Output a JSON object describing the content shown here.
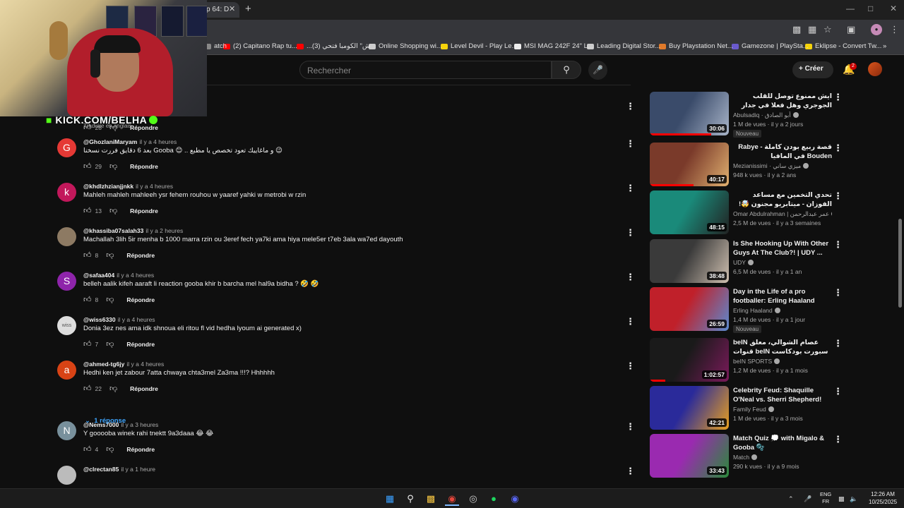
{
  "browser": {
    "tab_title": "p 64: D",
    "tab_close": "✕",
    "new_tab": "+",
    "bookmarks": [
      {
        "label": "atch",
        "color": "#888888"
      },
      {
        "label": "(2) Capitano Rap tu...",
        "color": "#ff0000"
      },
      {
        "label": "...ش\" الكومبا فتحي (3)",
        "color": "#ff0000"
      },
      {
        "label": "Online Shopping wi...",
        "color": "#cccccc"
      },
      {
        "label": "Level Devil - Play Le...",
        "color": "#f5d30a"
      },
      {
        "label": "MSI MAG 242F 24\" L...",
        "color": "#eeeeee"
      },
      {
        "label": "Leading Digital Stor...",
        "color": "#cccccc"
      },
      {
        "label": "Buy Playstation Net...",
        "color": "#e07a2a"
      },
      {
        "label": "Gamezone | PlaySta...",
        "color": "#6a5acd"
      },
      {
        "label": "Eklipse - Convert Tw...",
        "color": "#f5d30a"
      }
    ],
    "bookmarks_more": "»"
  },
  "stream_overlay": {
    "kick_text": "KICK.COM/BELHA",
    "peek_text": "Traduire en anglais"
  },
  "youtube": {
    "search_placeholder": "Rechercher",
    "create_label": "Créer",
    "notif_count": "2"
  },
  "comments": [
    {
      "author": "",
      "time": "",
      "text": "",
      "likes": "28",
      "reply": "Répondre",
      "avatar_text": "",
      "avatar_color": "#0f0f0f"
    },
    {
      "author": "@GhozlaniMaryam",
      "time": "il y a 4 heures",
      "text": "بعد 6 دقايق فررت نسخنا Gooba 😊 .. و ماغاييك تعود تخصص يا مطبع 😉",
      "likes": "29",
      "reply": "Répondre",
      "avatar_text": "G",
      "avatar_color": "#e53935"
    },
    {
      "author": "@khdlzhzianjjnkk",
      "time": "il y a 4 heures",
      "text": "Mahleh mahleh mahleeh ysr fehem rouhou w yaaref yahki w metrobi w rzin",
      "likes": "13",
      "reply": "Répondre",
      "avatar_text": "k",
      "avatar_color": "#c2185b"
    },
    {
      "author": "@khassiba07salah33",
      "time": "il y a 2 heures",
      "text": "Machallah 3lih 5ir menha b 1000 marra rzin ou 3eref fech ya7ki ama hiya mele5er t7eb 3ala wa7ed dayouth",
      "likes": "8",
      "reply": "Répondre",
      "avatar_text": "",
      "avatar_color": "#8d7a63"
    },
    {
      "author": "@safaa404",
      "time": "il y a 4 heures",
      "text": "belleh aalik kifeh aaraft li reaction gooba khir b barcha mel hal9a bidha ? 🤣 🤣",
      "likes": "8",
      "reply": "Répondre",
      "avatar_text": "S",
      "avatar_color": "#8e24aa"
    },
    {
      "author": "@wiss6330",
      "time": "il y a 4 heures",
      "text": "Donia 3ez nes ama idk shnoua eli ritou fl vid hedha lyoum ai generated x)",
      "likes": "7",
      "reply": "Répondre",
      "avatar_text": "wiss",
      "avatar_color": "#dddddd"
    },
    {
      "author": "@ahmed-tg6jy",
      "time": "il y a 4 heures",
      "text": "Hedhi ken jet zabour 7atta chwaya chta3mel Za3ma !!!? Hhhhhh",
      "likes": "22",
      "reply": "Répondre",
      "avatar_text": "a",
      "avatar_color": "#d84315"
    },
    {
      "author": "@Nems7000",
      "time": "il y a 3 heures",
      "text": "Y gooooba winek rahi tnektt 9a3daaa 😂 😂",
      "likes": "4",
      "reply": "Répondre",
      "avatar_text": "N",
      "avatar_color": "#78909c"
    },
    {
      "author": "@clrectan85",
      "time": "il y a 1 heure",
      "text": "",
      "likes": "",
      "reply": "",
      "avatar_text": "",
      "avatar_color": "#bbbbbb"
    }
  ],
  "replies_toggle": "1 réponse",
  "related": [
    {
      "title": "ايش ممنوع توصل للقلب الجوجري وهل فعلا في جدار جليدي ... حقيقة الكل خايف يواجهها",
      "rtl": true,
      "channel": "Abulsadiq · أبو الصادق",
      "meta": "1 M de vues · il y a 2 jours",
      "badge": "Nouveau",
      "duration": "30:06",
      "thumb": "#3a4b6a",
      "thumb2": "#a8b4c8",
      "progress": 0.78
    },
    {
      "title": "قصة ربيع بودن كاملة - Rabye Bouden في المافيا",
      "rtl": true,
      "channel": "Mezianissimi · ميزي ساني",
      "meta": "948 k vues · il y a 2 ans",
      "badge": "",
      "duration": "40:17",
      "thumb": "#7a3a2a",
      "thumb2": "#e0b070",
      "progress": 0.55
    },
    {
      "title": "تحدي التخمين مع مساعد الفوزان - ميتابريو مجنون 🤯!",
      "rtl": true,
      "channel": "Omar Abdulrahman | عمر عبدالرحمن",
      "meta": "2,5 M de vues · il y a 3 semaines",
      "badge": "",
      "duration": "48:15",
      "thumb": "#1a8a7a",
      "thumb2": "#222222",
      "progress": 0
    },
    {
      "title": "Is She Hooking Up With Other Guys At The Club?! | UDY ...",
      "rtl": false,
      "channel": "UDY",
      "meta": "6,5 M de vues · il y a 1 an",
      "badge": "",
      "duration": "38:48",
      "thumb": "#3a3a3a",
      "thumb2": "#cfc0b0",
      "progress": 0
    },
    {
      "title": "Day in the Life of a pro footballer: Erling Haaland",
      "rtl": false,
      "channel": "Erling Haaland",
      "meta": "1,4 M de vues · il y a 1 jour",
      "badge": "Nouveau",
      "duration": "26:59",
      "thumb": "#c0202a",
      "thumb2": "#5a8ad0",
      "progress": 0
    },
    {
      "title": "beIN عصام الشوالي، معلق قنوات beIN سبورت بودكاست SPORTS",
      "rtl": false,
      "channel": "beIN SPORTS",
      "meta": "1,2 M de vues · il y a 1 mois",
      "badge": "",
      "duration": "1:02:57",
      "thumb": "#1a1a1a",
      "thumb2": "#7a1a5a",
      "progress": 0.2
    },
    {
      "title": "Celebrity Feud: Shaquille O'Neal vs. Sherri Shepherd!",
      "rtl": false,
      "channel": "Family Feud",
      "meta": "1 M de vues · il y a 3 mois",
      "badge": "",
      "duration": "42:21",
      "thumb": "#2a2a9a",
      "thumb2": "#e8a020",
      "progress": 0
    },
    {
      "title": "Match Quiz 💭 with Migalo & Gooba 🫧",
      "rtl": false,
      "channel": "Match",
      "meta": "290 k vues · il y a 9 mois",
      "badge": "",
      "duration": "33:43",
      "thumb": "#9a2ab0",
      "thumb2": "#2a8a3a",
      "progress": 0
    }
  ],
  "taskbar": {
    "lang_top": "ENG",
    "lang_bottom": "FR",
    "time": "12:26 AM",
    "date": "10/25/2025"
  }
}
